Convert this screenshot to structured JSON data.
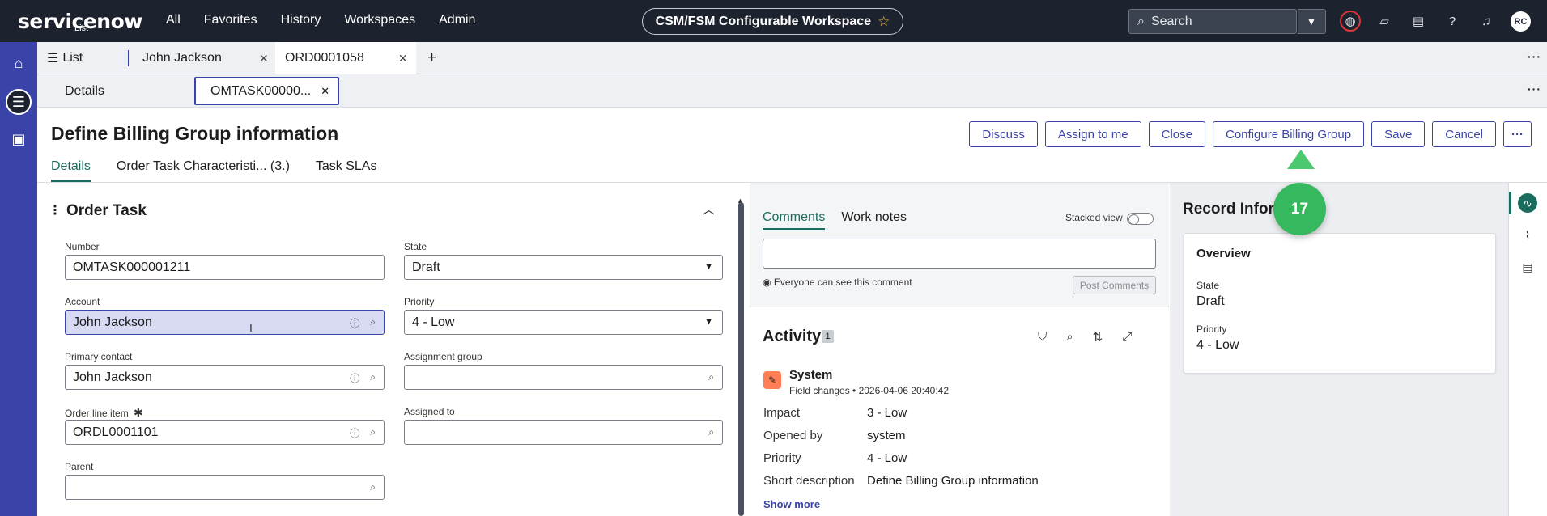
{
  "topnav": {
    "logo": "servicenow",
    "logo_sub": "List",
    "links": [
      "All",
      "Favorites",
      "History",
      "Workspaces",
      "Admin"
    ],
    "workspace": "CSM/FSM Configurable Workspace",
    "search_placeholder": "Search",
    "avatar": "RC"
  },
  "tabs": {
    "list_label": "List",
    "tab_1": "John Jackson",
    "tab_2": "ORD0001058"
  },
  "subtabs": {
    "details": "Details",
    "record": "OMTASK00000..."
  },
  "record": {
    "title": "Define Billing Group information",
    "actions": [
      "Discuss",
      "Assign to me",
      "Close",
      "Configure Billing Group",
      "Save",
      "Cancel"
    ],
    "form_tabs": [
      "Details",
      "Order Task Characteristi... (3.)",
      "Task SLAs"
    ]
  },
  "form": {
    "section": "Order Task",
    "number_label": "Number",
    "number_value": "OMTASK000001211",
    "state_label": "State",
    "state_value": "Draft",
    "account_label": "Account",
    "account_value": "John Jackson",
    "priority_label": "Priority",
    "priority_value": "4 - Low",
    "contact_label": "Primary contact",
    "contact_value": "John Jackson",
    "assign_group_label": "Assignment group",
    "line_item_label": "Order line item",
    "line_item_value": "ORDL0001101",
    "assigned_to_label": "Assigned to",
    "parent_label": "Parent"
  },
  "comments": {
    "tab_comments": "Comments",
    "tab_worknotes": "Work notes",
    "stacked": "Stacked view",
    "everyone": "Everyone can see this comment",
    "post": "Post Comments"
  },
  "activity": {
    "title": "Activity",
    "count": "1",
    "author": "System",
    "meta": "Field changes • 2026-04-06 20:40:42",
    "rows": [
      {
        "k": "Impact",
        "v": "3 - Low"
      },
      {
        "k": "Opened by",
        "v": "system"
      },
      {
        "k": "Priority",
        "v": "4 - Low"
      },
      {
        "k": "Short description",
        "v": "Define Billing Group information"
      }
    ],
    "show_more": "Show more"
  },
  "record_info": {
    "title": "Record Inform",
    "overview": "Overview",
    "state_label": "State",
    "state_value": "Draft",
    "priority_label": "Priority",
    "priority_value": "4 - Low"
  },
  "step": "17",
  "colors": {
    "nav": "#1c222e",
    "rail": "#3a44a8",
    "accent_green": "#1a6d5e",
    "badge": "#36b85e"
  }
}
